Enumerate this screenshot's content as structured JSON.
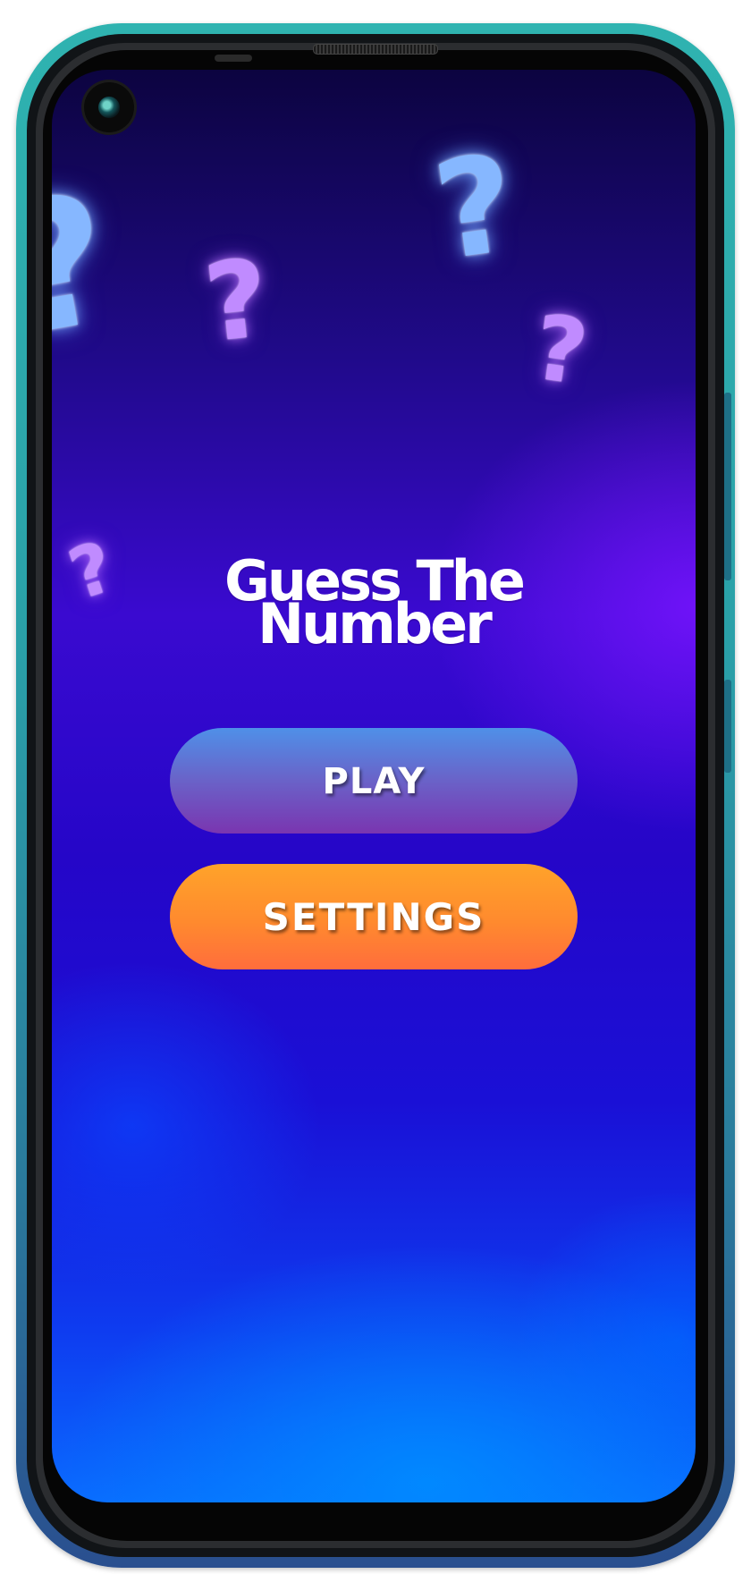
{
  "app": {
    "title_line_1": "Guess The",
    "title_line_2": "Number"
  },
  "buttons": {
    "play_label": "PLAY",
    "settings_label": "SETTINGS"
  },
  "decorations": {
    "glyph": "?"
  },
  "colors": {
    "play_button_top": "#4f90e8",
    "play_button_bottom": "#7a35b0",
    "settings_button_top": "#ffa32a",
    "settings_button_bottom": "#ff6d3c",
    "background_top": "#0c0440",
    "background_mid": "#3a0ad0",
    "background_bottom": "#0a6bff",
    "phone_frame": "#2fb3b0",
    "question_mark_purple": "#c08bff",
    "question_mark_blue": "#86b7ff"
  }
}
